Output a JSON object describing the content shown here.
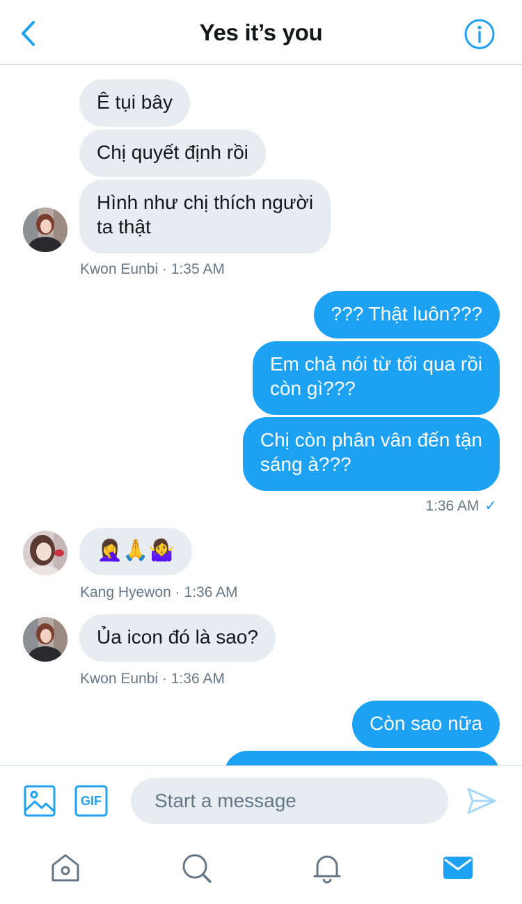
{
  "header": {
    "title": "Yes it’s you",
    "back_icon": "chevron-left-icon",
    "info_icon": "info-icon"
  },
  "colors": {
    "accent": "#1da1f2",
    "incoming_bubble": "#e6ecf0",
    "meta_text": "#657786"
  },
  "messages": [
    {
      "sender": "Kwon Eunbi",
      "direction": "in",
      "lines": [
        "Ê tụi bây"
      ]
    },
    {
      "sender": "Kwon Eunbi",
      "direction": "in",
      "lines": [
        "Chị quyết định rồi"
      ]
    },
    {
      "sender": "Kwon Eunbi",
      "direction": "in",
      "lines": [
        "Hình như chị thích người",
        "ta thật"
      ]
    },
    {
      "direction": "out",
      "lines": [
        "??? Thật luôn???"
      ]
    },
    {
      "direction": "out",
      "lines": [
        "Em chả nói từ tối qua rồi",
        "còn gì???"
      ]
    },
    {
      "direction": "out",
      "lines": [
        "Chị còn phân vân đến tận",
        "sáng à???"
      ]
    },
    {
      "sender": "Kang Hyewon",
      "direction": "in",
      "lines": [
        "🤦‍♀️🙏🤷‍♀️"
      ]
    },
    {
      "sender": "Kwon Eunbi",
      "direction": "in",
      "lines": [
        "Ủa icon đó là sao?"
      ]
    },
    {
      "direction": "out",
      "lines": [
        "Còn sao nữa"
      ]
    }
  ],
  "meta": {
    "group1": {
      "name": "Kwon Eunbi",
      "sep": "·",
      "time": "1:35 AM"
    },
    "sent1": {
      "time": "1:36 AM",
      "check": "✓"
    },
    "group2": {
      "name": "Kang Hyewon",
      "sep": "·",
      "time": "1:36 AM"
    },
    "group3": {
      "name": "Kwon Eunbi",
      "sep": "·",
      "time": "1:36 AM"
    }
  },
  "composer": {
    "placeholder": "Start a message",
    "value": "",
    "image_icon": "image-icon",
    "gif_label": "GIF",
    "send_icon": "send-icon"
  },
  "tabbar": {
    "items": [
      "home-icon",
      "search-icon",
      "notifications-bell-icon",
      "messages-envelope-icon"
    ],
    "active": "messages-envelope-icon"
  }
}
